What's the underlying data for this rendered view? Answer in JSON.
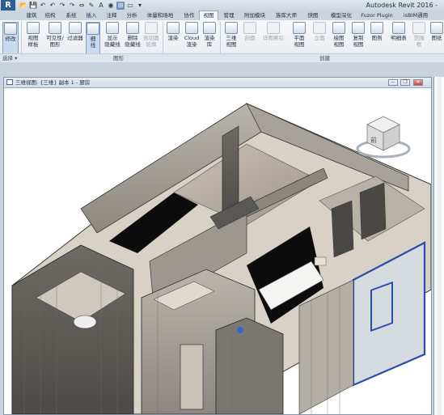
{
  "app": {
    "logo": "R",
    "title": "Autodesk Revit 2016 -",
    "quick_access": [
      "📂",
      "💾",
      "↶",
      "↶",
      "↷",
      "↷",
      "⇔",
      "✎",
      "A",
      "◉",
      "⊞",
      "▭",
      "▾"
    ]
  },
  "tabs": [
    {
      "label": "建筑"
    },
    {
      "label": "结构"
    },
    {
      "label": "系统"
    },
    {
      "label": "插入"
    },
    {
      "label": "注释"
    },
    {
      "label": "分析"
    },
    {
      "label": "体量和场地"
    },
    {
      "label": "协作"
    },
    {
      "label": "视图"
    },
    {
      "label": "管理"
    },
    {
      "label": "附加模块"
    },
    {
      "label": "族库大师"
    },
    {
      "label": "快图"
    },
    {
      "label": "模型深化"
    },
    {
      "label": "Fuzor Plugin"
    },
    {
      "label": "isBIM通用"
    }
  ],
  "ribbon": {
    "buttons": [
      {
        "label": "修改",
        "name": "modify-button"
      },
      {
        "label": "视图\n样板",
        "name": "view-template-button"
      },
      {
        "label": "可见性/\n图形",
        "name": "visibility-graphics-button"
      },
      {
        "label": "过滤器",
        "name": "filters-button"
      },
      {
        "label": "细\n线",
        "name": "thin-lines-button"
      },
      {
        "label": "显示\n隐藏线",
        "name": "show-hidden-lines-button"
      },
      {
        "label": "删除\n隐藏线",
        "name": "remove-hidden-lines-button"
      },
      {
        "label": "剖切面\n轮廓",
        "name": "cut-profile-button"
      },
      {
        "label": "渲染",
        "name": "render-button"
      },
      {
        "label": "Cloud\n渲染",
        "name": "cloud-render-button"
      },
      {
        "label": "渲染\n库",
        "name": "render-gallery-button"
      },
      {
        "label": "三维\n视图",
        "name": "3d-view-button"
      },
      {
        "label": "剖面",
        "name": "section-button"
      },
      {
        "label": "详图索引",
        "name": "callout-button"
      },
      {
        "label": "平面\n视图",
        "name": "plan-views-button"
      },
      {
        "label": "立面",
        "name": "elevation-button"
      },
      {
        "label": "绘图\n视图",
        "name": "drafting-view-button"
      },
      {
        "label": "复制\n视图",
        "name": "duplicate-view-button"
      },
      {
        "label": "图例",
        "name": "legends-button"
      },
      {
        "label": "明细表",
        "name": "schedules-button"
      },
      {
        "label": "范围\n框",
        "name": "scope-box-button"
      },
      {
        "label": "图纸",
        "name": "sheet-button"
      }
    ],
    "panels": [
      "选择 ▾",
      "图形",
      "创建"
    ]
  },
  "view": {
    "title": "三维视图: {三维} 副本 1 - 厨房",
    "buttons": [
      "—",
      "❐",
      "✕"
    ]
  },
  "viewcube": {
    "face": "前"
  }
}
